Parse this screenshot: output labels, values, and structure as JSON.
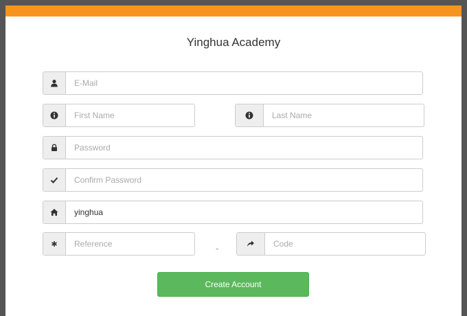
{
  "form": {
    "title": "Yinghua Academy",
    "email_placeholder": "E-Mail",
    "first_name_placeholder": "First Name",
    "last_name_placeholder": "Last Name",
    "password_placeholder": "Password",
    "confirm_password_placeholder": "Confirm Password",
    "school_value": "yinghua",
    "reference_placeholder": "Reference",
    "separator": "-",
    "code_placeholder": "Code",
    "submit_label": "Create Account"
  },
  "icons": {
    "email": "user-icon",
    "first_name": "info-icon",
    "last_name": "info-icon",
    "password": "lock-icon",
    "confirm_password": "check-icon",
    "school": "home-icon",
    "reference": "asterisk-icon",
    "code": "share-icon"
  },
  "colors": {
    "accent_bar": "#f7941d",
    "button": "#5cb85c",
    "addon_bg": "#eeeeee"
  }
}
